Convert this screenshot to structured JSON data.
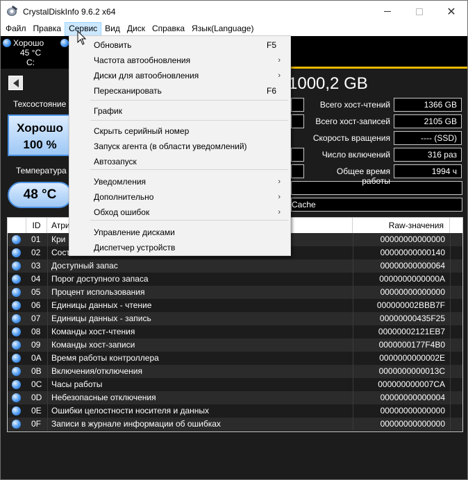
{
  "window": {
    "title": "CrystalDiskInfo 9.6.2 x64"
  },
  "menu": [
    "Файл",
    "Правка",
    "Сервис",
    "Вид",
    "Диск",
    "Справка",
    "Язык(Language)"
  ],
  "disk": {
    "status": "Хорошо",
    "temp": "45 °C",
    "letter": "C:"
  },
  "model_title": "1000,2 GB",
  "left_panel": {
    "health_label": "Техсостояние",
    "health_status": "Хорошо",
    "health_percent": "100 %",
    "temp_label": "Температура",
    "temp_value": "48 °C"
  },
  "right_stats": [
    {
      "label": "Всего хост-чтений",
      "value": "1366 GB"
    },
    {
      "label": "Всего хост-записей",
      "value": "2105 GB"
    },
    {
      "label": "Скорость вращения",
      "value": "---- (SSD)"
    },
    {
      "label": "Число включений",
      "value": "316 раз"
    },
    {
      "label": "Общее время работы",
      "value": "1994 ч"
    }
  ],
  "features_tail": "Cache",
  "table": {
    "headers": {
      "id": "ID",
      "attr": "Атри",
      "raw": "Raw-значения"
    },
    "rows": [
      {
        "id": "01",
        "name": "Кри",
        "raw": "00000000000000"
      },
      {
        "id": "02",
        "name": "Сост",
        "raw": "00000000000140"
      },
      {
        "id": "03",
        "name": "Доступный запас",
        "raw": "00000000000064"
      },
      {
        "id": "04",
        "name": "Порог доступного запаса",
        "raw": "0000000000000A"
      },
      {
        "id": "05",
        "name": "Процент использования",
        "raw": "00000000000000"
      },
      {
        "id": "06",
        "name": "Единицы данных - чтение",
        "raw": "000000002BBB7F"
      },
      {
        "id": "07",
        "name": "Единицы данных - запись",
        "raw": "00000000435F25"
      },
      {
        "id": "08",
        "name": "Команды хост-чтения",
        "raw": "00000002121EB7"
      },
      {
        "id": "09",
        "name": "Команды хост-записи",
        "raw": "0000000177F4B0"
      },
      {
        "id": "0A",
        "name": "Время работы контроллера",
        "raw": "0000000000002E"
      },
      {
        "id": "0B",
        "name": "Включения/отключения",
        "raw": "0000000000013C"
      },
      {
        "id": "0C",
        "name": "Часы работы",
        "raw": "000000000007CA"
      },
      {
        "id": "0D",
        "name": "Небезопасные отключения",
        "raw": "00000000000004"
      },
      {
        "id": "0E",
        "name": "Ошибки целостности носителя и данных",
        "raw": "00000000000000"
      },
      {
        "id": "0F",
        "name": "Записи в журнале информации об ошибках",
        "raw": "00000000000000"
      }
    ]
  },
  "dropdown": [
    {
      "label": "Обновить",
      "shortcut": "F5",
      "sub": false
    },
    {
      "label": "Частота автообновления",
      "shortcut": "",
      "sub": true
    },
    {
      "label": "Диски для автообновления",
      "shortcut": "",
      "sub": true
    },
    {
      "label": "Пересканировать",
      "shortcut": "F6",
      "sub": false
    },
    {
      "label": "График",
      "shortcut": "",
      "sub": false
    },
    {
      "label": "Скрыть серийный номер",
      "shortcut": "",
      "sub": false
    },
    {
      "label": "Запуск агента (в области уведомлений)",
      "shortcut": "",
      "sub": false
    },
    {
      "label": "Автозапуск",
      "shortcut": "",
      "sub": false
    },
    {
      "label": "Уведомления",
      "shortcut": "",
      "sub": true
    },
    {
      "label": "Дополнительно",
      "shortcut": "",
      "sub": true
    },
    {
      "label": "Обход ошибок",
      "shortcut": "",
      "sub": true
    },
    {
      "label": "Управление дисками",
      "shortcut": "",
      "sub": false
    },
    {
      "label": "Диспетчер устройств",
      "shortcut": "",
      "sub": false
    }
  ]
}
